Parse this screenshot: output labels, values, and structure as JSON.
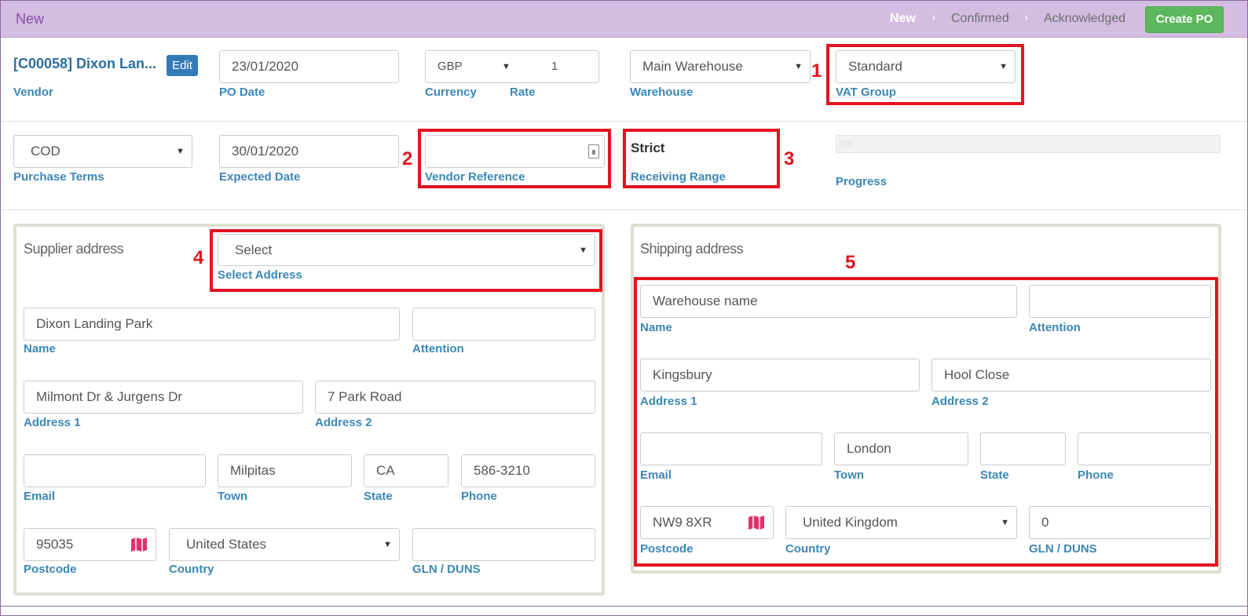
{
  "header": {
    "status": "New",
    "steps": [
      "New",
      "Confirmed",
      "Acknowledged"
    ],
    "create_label": "Create PO"
  },
  "vendor": {
    "name": "[C00058] Dixon Lan...",
    "edit_label": "Edit",
    "label": "Vendor"
  },
  "po_date": {
    "value": "23/01/2020",
    "label": "PO Date"
  },
  "currency": {
    "value": "GBP",
    "label": "Currency"
  },
  "rate": {
    "value": "1",
    "label": "Rate"
  },
  "warehouse": {
    "value": "Main Warehouse",
    "label": "Warehouse"
  },
  "vat_group": {
    "value": "Standard",
    "label": "VAT Group"
  },
  "purchase_terms": {
    "value": "COD",
    "label": "Purchase Terms"
  },
  "expected_date": {
    "value": "30/01/2020",
    "label": "Expected Date"
  },
  "vendor_reference": {
    "value": "",
    "label": "Vendor Reference"
  },
  "receiving_range": {
    "value": "Strict",
    "label": "Receiving Range"
  },
  "progress": {
    "value": "0%",
    "label": "Progress",
    "fraction": 0
  },
  "annotations": [
    "1",
    "2",
    "3",
    "4",
    "5"
  ],
  "supplier": {
    "title": "Supplier address",
    "select": {
      "value": "Select",
      "label": "Select Address"
    },
    "name": {
      "value": "Dixon Landing Park",
      "label": "Name"
    },
    "attention": {
      "value": "",
      "label": "Attention"
    },
    "address1": {
      "value": "Milmont Dr & Jurgens Dr",
      "label": "Address 1"
    },
    "address2": {
      "value": "7 Park Road",
      "label": "Address 2"
    },
    "email": {
      "value": "",
      "label": "Email"
    },
    "town": {
      "value": "Milpitas",
      "label": "Town"
    },
    "state": {
      "value": "CA",
      "label": "State"
    },
    "phone": {
      "value": "586-3210",
      "label": "Phone"
    },
    "postcode": {
      "value": "95035",
      "label": "Postcode"
    },
    "country": {
      "value": "United States",
      "label": "Country"
    },
    "gln": {
      "value": "",
      "label": "GLN / DUNS"
    }
  },
  "shipping": {
    "title": "Shipping address",
    "name": {
      "value": "Warehouse name",
      "label": "Name"
    },
    "attention": {
      "value": "",
      "label": "Attention"
    },
    "address1": {
      "value": "Kingsbury",
      "label": "Address 1"
    },
    "address2": {
      "value": "Hool Close",
      "label": "Address 2"
    },
    "email": {
      "value": "",
      "label": "Email"
    },
    "town": {
      "value": "London",
      "label": "Town"
    },
    "state": {
      "value": "",
      "label": "State"
    },
    "phone": {
      "value": "",
      "label": "Phone"
    },
    "postcode": {
      "value": "NW9 8XR",
      "label": "Postcode"
    },
    "country": {
      "value": "United Kingdom",
      "label": "Country"
    },
    "gln": {
      "value": "0",
      "label": "GLN / DUNS"
    }
  },
  "colors": {
    "header_bg": "#d4bde0",
    "accent_label": "#3a87b6",
    "create_button": "#5cb85c",
    "annotation_red": "#e3141f"
  },
  "icons": [
    "chevron-right-icon",
    "caret-down-icon",
    "contact-card-icon",
    "map-icon"
  ]
}
